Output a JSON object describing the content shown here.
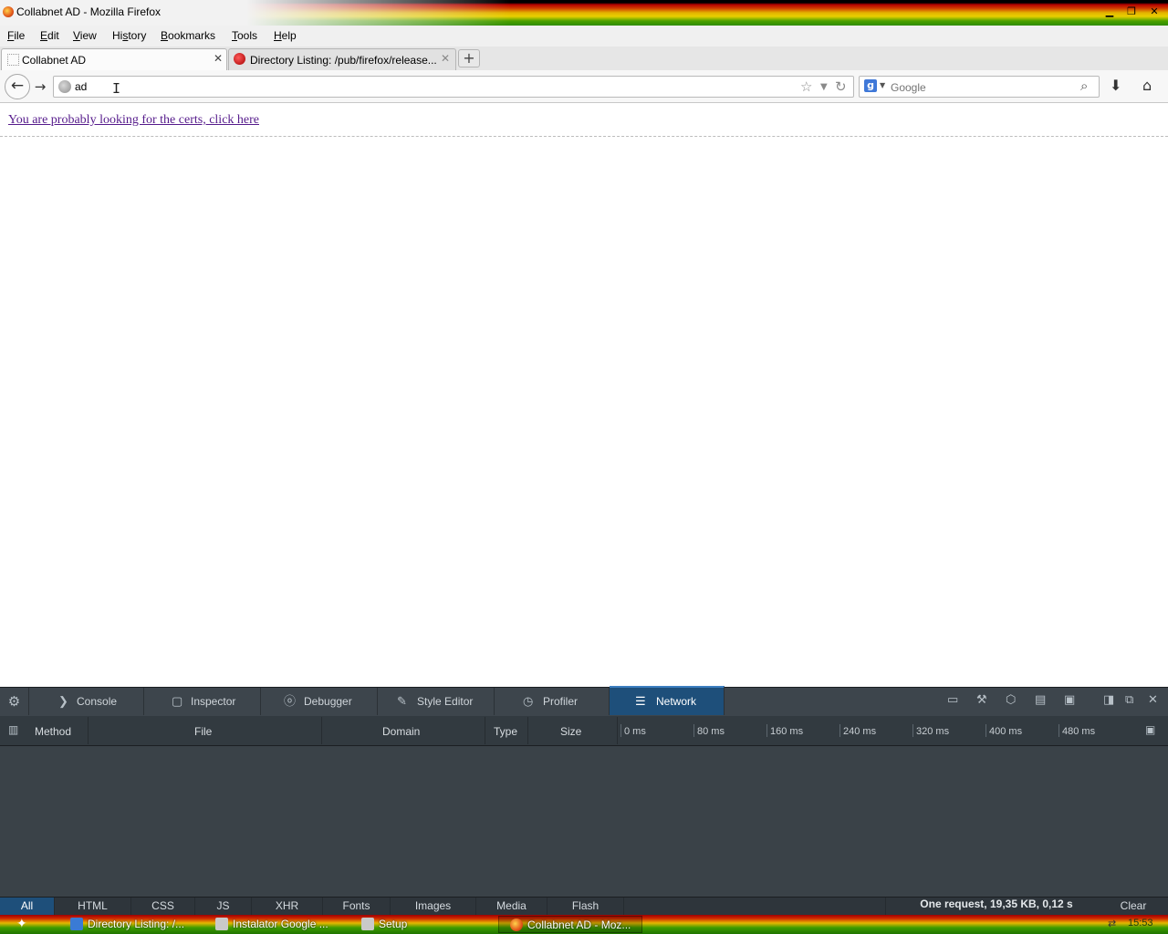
{
  "window": {
    "title": "Collabnet AD - Mozilla Firefox",
    "minimize_icon": "minimize-icon",
    "restore_icon": "restore-icon",
    "close_icon": "close-icon"
  },
  "menu": {
    "file": {
      "u": "F",
      "rest": "ile"
    },
    "edit": {
      "u": "E",
      "rest": "dit"
    },
    "view": {
      "u": "V",
      "rest": "iew"
    },
    "history": {
      "pre": "Hi",
      "u": "s",
      "rest": "tory"
    },
    "bookmarks": {
      "u": "B",
      "rest": "ookmarks"
    },
    "tools": {
      "u": "T",
      "rest": "ools"
    },
    "help": {
      "u": "H",
      "rest": "elp"
    }
  },
  "tabs": [
    {
      "label": "Collabnet AD",
      "active": true
    },
    {
      "label": "Directory Listing: /pub/firefox/release...",
      "active": false
    }
  ],
  "navbar": {
    "url_value": "ad",
    "search_placeholder": "Google",
    "search_engine_letter": "g"
  },
  "content": {
    "link_text": "You are probably looking for the certs, click here"
  },
  "devtools": {
    "tabs": [
      "Console",
      "Inspector",
      "Debugger",
      "Style Editor",
      "Profiler",
      "Network"
    ],
    "active_tab": "Network",
    "columns": {
      "method": "Method",
      "file": "File",
      "domain": "Domain",
      "type": "Type",
      "size": "Size"
    },
    "ticks": [
      "0 ms",
      "80 ms",
      "160 ms",
      "240 ms",
      "320 ms",
      "400 ms",
      "480 ms"
    ],
    "filters": [
      "All",
      "HTML",
      "CSS",
      "JS",
      "XHR",
      "Fonts",
      "Images",
      "Media",
      "Flash"
    ],
    "active_filter": "All",
    "summary": "One request, 19,35 KB, 0,12 s",
    "clear_label": "Clear"
  },
  "taskbar": {
    "items": [
      {
        "label": "Directory Listing: /..."
      },
      {
        "label": "Instalator Google ..."
      },
      {
        "label": "Setup"
      },
      {
        "label": "Collabnet AD - Moz..."
      }
    ],
    "clock": "15:53"
  },
  "colors": {
    "link": "#551a8b",
    "devtools_bg": "#3a4248",
    "devtools_active": "#1e4f7a"
  }
}
